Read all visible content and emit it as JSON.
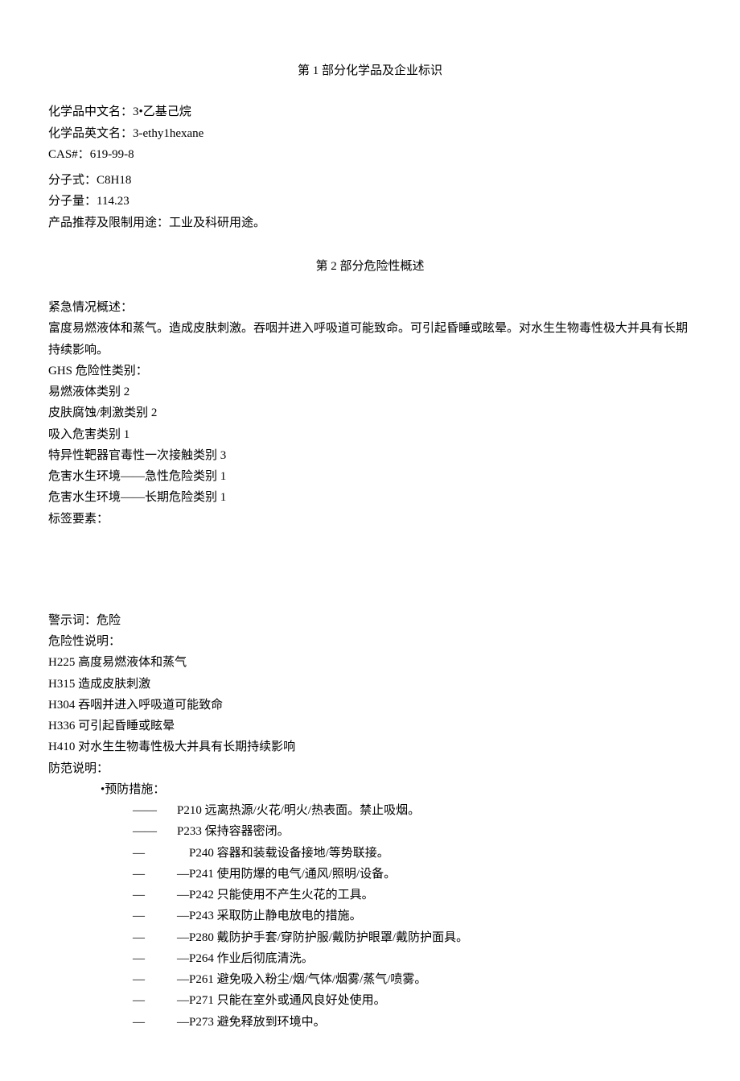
{
  "section1": {
    "title": "第 1 部分化学品及企业标识",
    "fields": {
      "name_cn_label": "化学品中文名：",
      "name_cn_value": "3•乙基己烷",
      "name_en_label": "化学品英文名：",
      "name_en_value": "3-ethy1hexane",
      "cas_label": "CAS#：",
      "cas_value": "619-99-8",
      "formula_label": "分子式：",
      "formula_value": "C8H18",
      "mw_label": "分子量：",
      "mw_value": "114.23",
      "use_label": "产品推荐及限制用途：",
      "use_value": "工业及科研用途。"
    }
  },
  "section2": {
    "title": "第 2 部分危险性概述",
    "overview_label": "紧急情况概述：",
    "overview_body": "富度易燃液体和蒸气。造成皮肤刺激。吞咽并进入呼吸道可能致命。可引起昏睡或眩晕。对水生生物毒性极大并具有长期持续影响。",
    "ghs_label": "GHS 危险性类别：",
    "ghs_classes": [
      "易燃液体类别 2",
      "皮肤腐蚀/刺激类别 2",
      "吸入危害类别 1",
      "特异性靶器官毒性一次接触类别 3",
      "危害水生环境——急性危险类别 1",
      "危害水生环境——长期危险类别 1"
    ],
    "label_elements": "标签要素：",
    "signal_word_label": "警示词：",
    "signal_word_value": "危险",
    "hazard_label": "危险性说明：",
    "hazard_statements": [
      "H225 高度易燃液体和蒸气",
      "H315 造成皮肤刺激",
      "H304 吞咽并进入呼吸道可能致命",
      "H336 可引起昏睡或眩晕",
      "H410 对水生生物毒性极大并具有长期持续影响"
    ],
    "precaution_label": "防范说明：",
    "prevention_lead": "•预防措施：",
    "prevention_items": [
      {
        "dash": "——",
        "text": "P210 远离热源/火花/明火/热表面。禁止吸烟。"
      },
      {
        "dash": "——",
        "text": "P233 保持容器密闭。"
      },
      {
        "dash": "—",
        "text": "P240 容器和装载设备接地/等势联接。",
        "indent": true
      },
      {
        "dash": "—",
        "text": "—P241 使用防爆的电气/通风/照明/设备。",
        "indent": true
      },
      {
        "dash": "—",
        "text": "—P242 只能使用不产生火花的工具。",
        "indent": true
      },
      {
        "dash": "—",
        "text": "—P243 采取防止静电放电的措施。",
        "indent": true
      },
      {
        "dash": "—",
        "text": "—P280 戴防护手套/穿防护服/戴防护眼罩/戴防护面具。",
        "indent": true
      },
      {
        "dash": "—",
        "text": "—P264 作业后彻底清洗。",
        "indent": true
      },
      {
        "dash": "—",
        "text": "—P261 避免吸入粉尘/烟/气体/烟雾/蒸气/喷雾。",
        "indent": true
      },
      {
        "dash": "—",
        "text": "—P271 只能在室外或通风良好处使用。",
        "indent": true
      },
      {
        "dash": "—",
        "text": "—P273 避免释放到环境中。",
        "indent": true
      }
    ]
  }
}
